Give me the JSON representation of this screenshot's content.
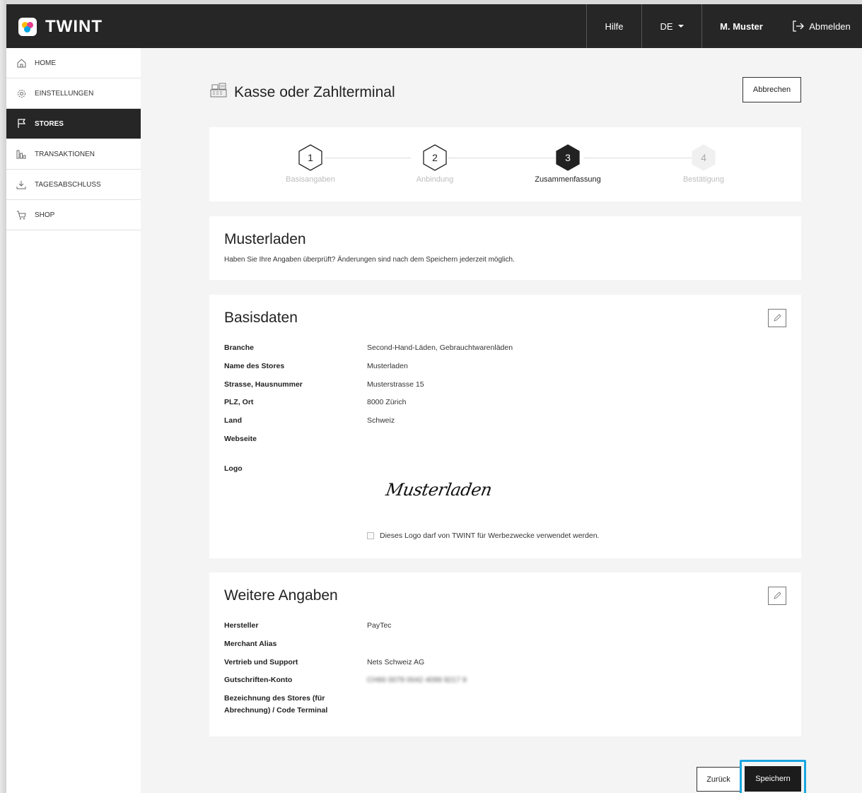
{
  "header": {
    "brand": "TWINT",
    "help": "Hilfe",
    "language": "DE",
    "user": "M. Muster",
    "logout": "Abmelden"
  },
  "sidebar": {
    "items": [
      {
        "label": "HOME",
        "icon": "home-icon"
      },
      {
        "label": "EINSTELLUNGEN",
        "icon": "gear-icon"
      },
      {
        "label": "STORES",
        "icon": "flag-icon",
        "active": true
      },
      {
        "label": "TRANSAKTIONEN",
        "icon": "bar-chart-icon"
      },
      {
        "label": "TAGESABSCHLUSS",
        "icon": "download-icon"
      },
      {
        "label": "SHOP",
        "icon": "cart-icon"
      }
    ]
  },
  "page": {
    "title": "Kasse oder Zahlterminal",
    "cancel": "Abbrechen"
  },
  "stepper": {
    "steps": [
      {
        "number": "1",
        "label": "Basisangaben",
        "state": "done"
      },
      {
        "number": "2",
        "label": "Anbindung",
        "state": "done"
      },
      {
        "number": "3",
        "label": "Zusammenfassung",
        "state": "current"
      },
      {
        "number": "4",
        "label": "Bestätigung",
        "state": "upcoming"
      }
    ]
  },
  "summary": {
    "title": "Musterladen",
    "subtitle": "Haben Sie Ihre Angaben überprüft? Änderungen sind nach dem Speichern jederzeit möglich."
  },
  "basisdaten": {
    "title": "Basisdaten",
    "rows": [
      {
        "label": "Branche",
        "value": "Second-Hand-Läden, Gebrauchtwarenläden"
      },
      {
        "label": "Name des Stores",
        "value": "Musterladen"
      },
      {
        "label": "Strasse, Hausnummer",
        "value": "Musterstrasse 15"
      },
      {
        "label": "PLZ, Ort",
        "value": "8000 Zürich"
      },
      {
        "label": "Land",
        "value": "Schweiz"
      },
      {
        "label": "Webseite",
        "value": ""
      }
    ],
    "logo_label": "Logo",
    "logo_image_text": "Musterladen",
    "logo_consent": "Dieses Logo darf von TWINT für Werbezwecke verwendet werden."
  },
  "weitere": {
    "title": "Weitere Angaben",
    "rows": [
      {
        "label": "Hersteller",
        "value": "PayTec"
      },
      {
        "label": "Merchant Alias",
        "value": ""
      },
      {
        "label": "Vertrieb und Support",
        "value": "Nets Schweiz AG"
      },
      {
        "label": "Gutschriften-Konto",
        "value": "CH66 0079 0042 4099 9217 9"
      },
      {
        "label_line1": "Bezeichnung des Stores (für",
        "label_line2": "Abrechnung) / Code Terminal",
        "value": ""
      }
    ]
  },
  "actions": {
    "back": "Zurück",
    "save": "Speichern"
  },
  "colors": {
    "header_bg": "#262626",
    "highlight": "#19a7e0"
  }
}
